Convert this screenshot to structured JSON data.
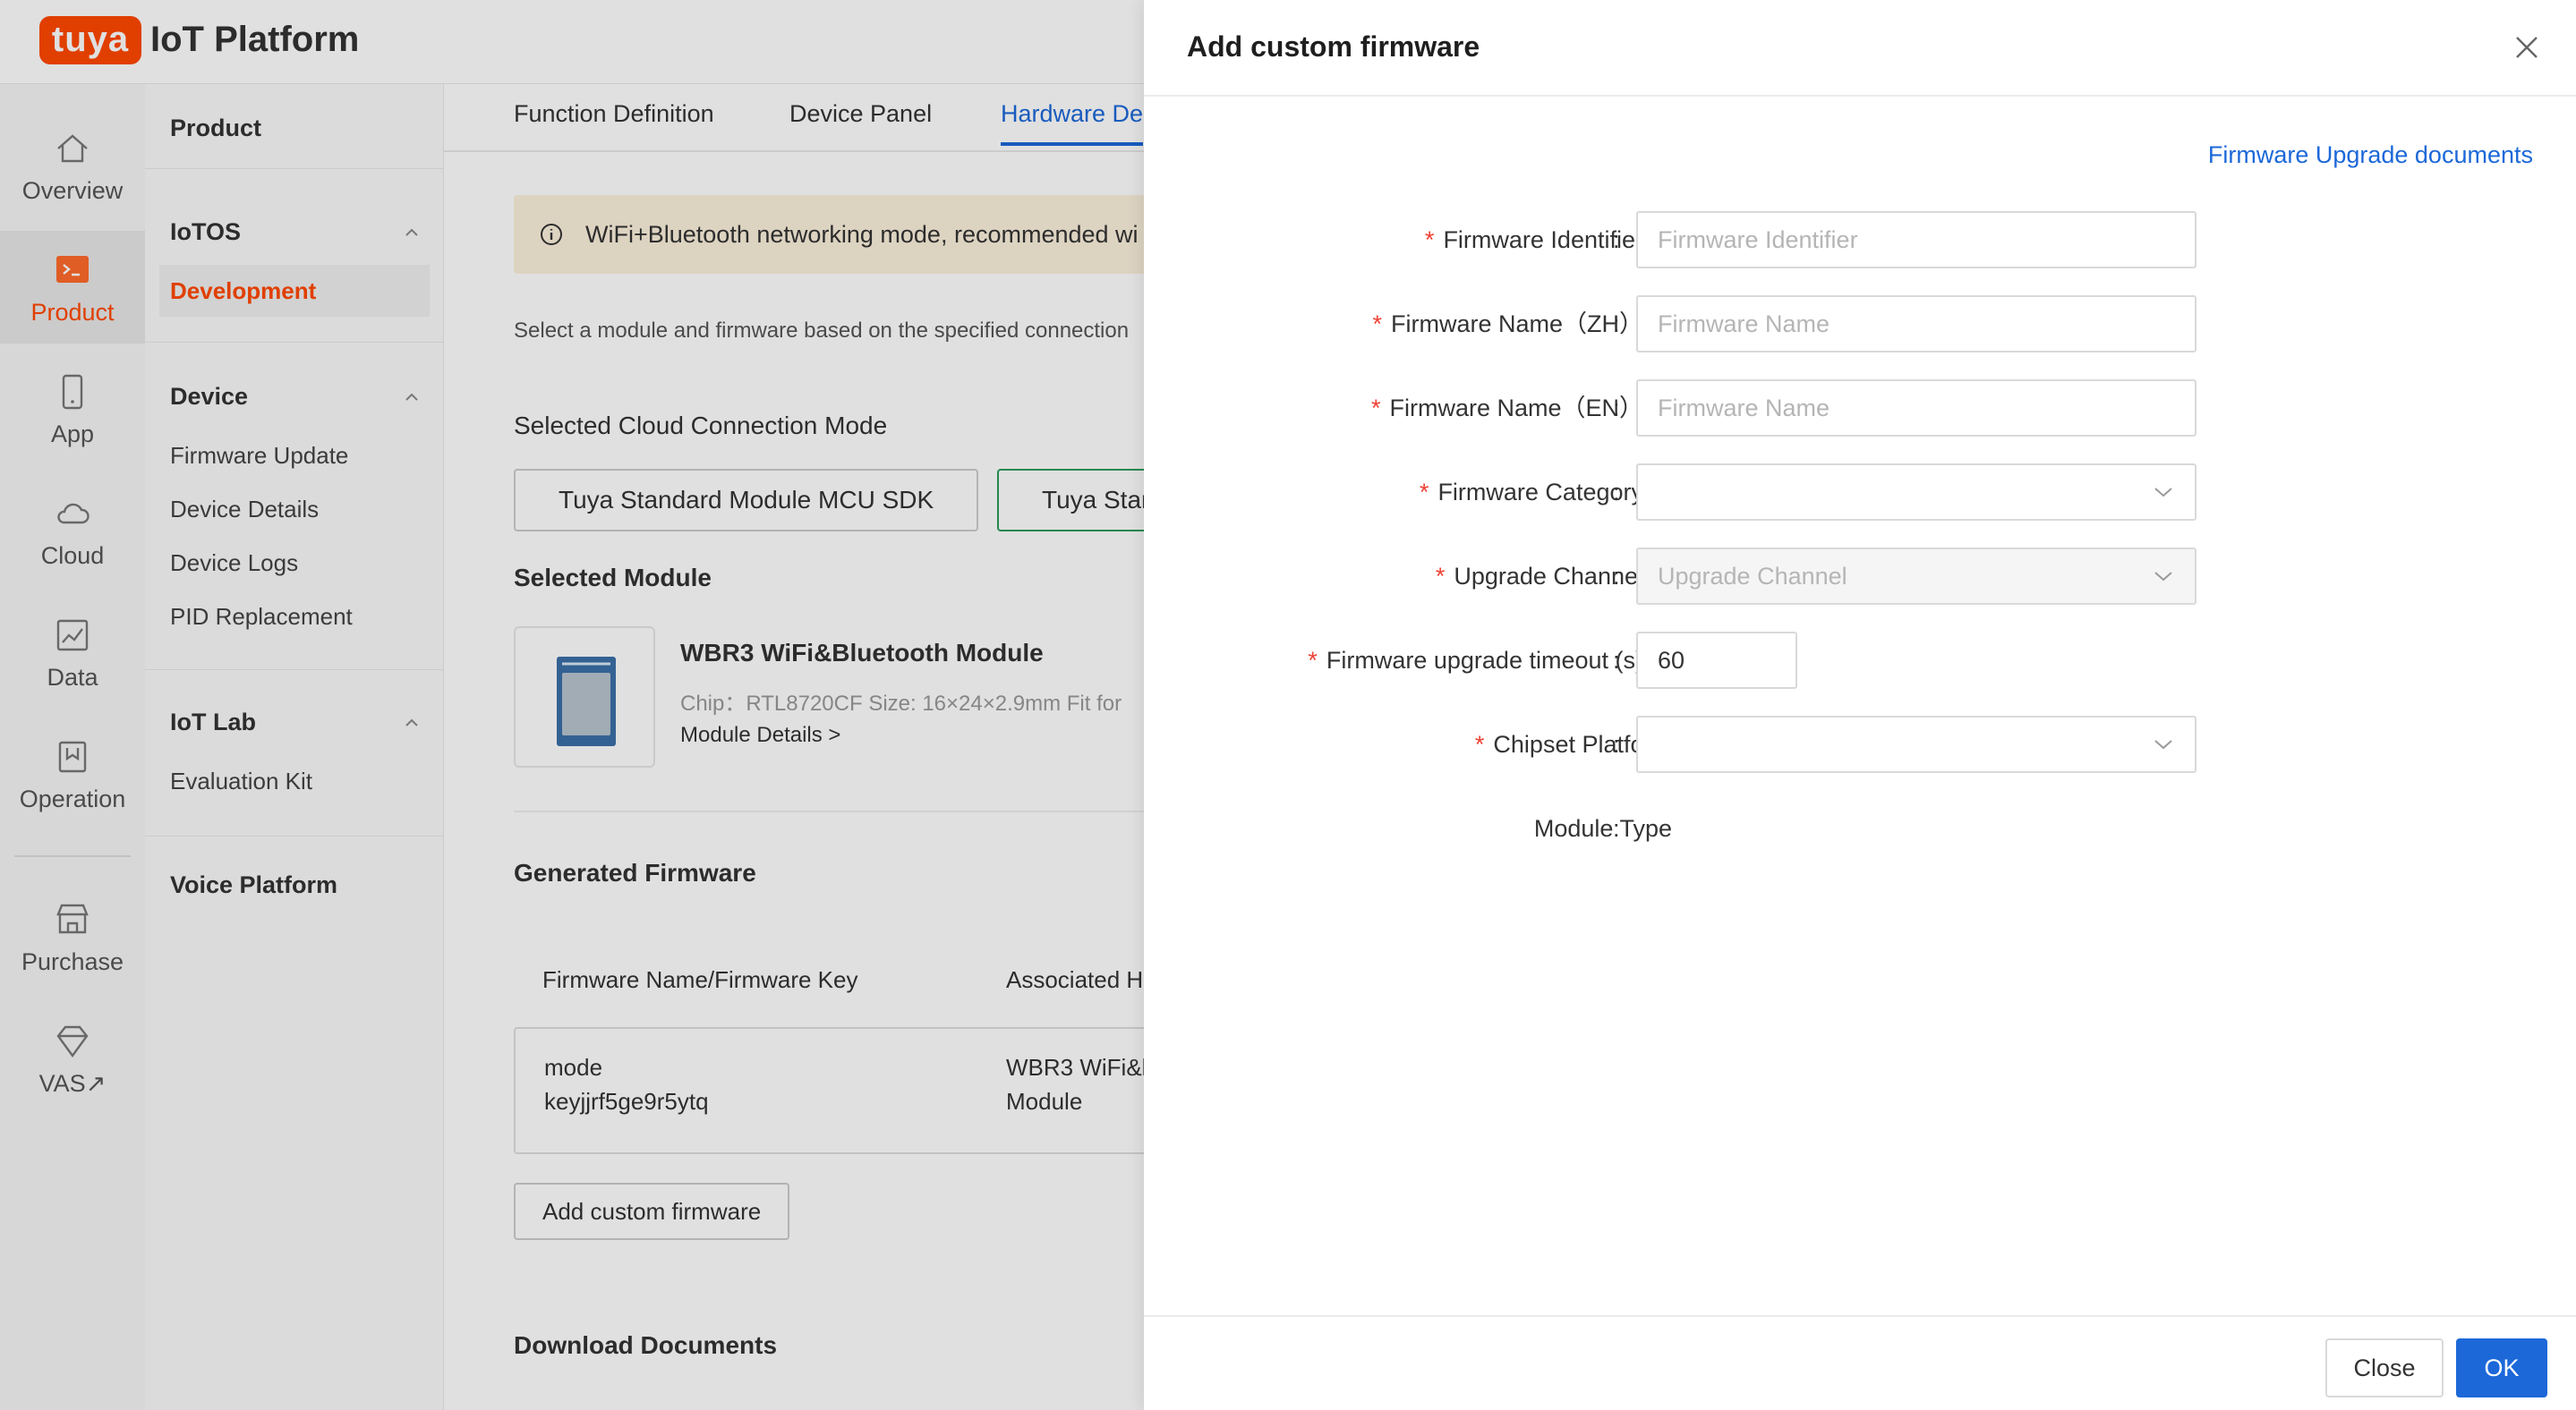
{
  "brand": {
    "logo_text": "tuya",
    "platform": "IoT Platform",
    "accent": "#ff4800"
  },
  "rail": {
    "items": [
      {
        "label": "Overview",
        "icon": "home-icon"
      },
      {
        "label": "Product",
        "icon": "terminal-icon",
        "active": true
      },
      {
        "label": "App",
        "icon": "phone-icon"
      },
      {
        "label": "Cloud",
        "icon": "cloud-icon"
      },
      {
        "label": "Data",
        "icon": "chart-icon"
      },
      {
        "label": "Operation",
        "icon": "bookmark-icon"
      },
      {
        "label": "Purchase",
        "icon": "shop-icon"
      },
      {
        "label": "VAS",
        "icon": "diamond-icon"
      }
    ],
    "vas_arrow": "↗"
  },
  "subnav": {
    "title": "Product",
    "groups": [
      {
        "label": "IoTOS",
        "items": [
          "Development"
        ]
      },
      {
        "label": "Device",
        "items": [
          "Firmware Update",
          "Device Details",
          "Device Logs",
          "PID Replacement"
        ]
      },
      {
        "label": "IoT Lab",
        "items": [
          "Evaluation Kit"
        ]
      }
    ],
    "voice": "Voice Platform"
  },
  "main": {
    "tabs": [
      "Function Definition",
      "Device Panel",
      "Hardware De"
    ],
    "alert": "WiFi+Bluetooth networking mode, recommended wi",
    "select_hint": "Select a module and firmware based on the specified connection",
    "conn_mode_heading": "Selected Cloud Connection Mode",
    "mode_buttons": [
      "Tuya Standard Module MCU SDK",
      "Tuya Star"
    ],
    "selected_module_heading": "Selected Module",
    "module": {
      "name": "WBR3 WiFi&Bluetooth Module",
      "specs": "Chip：RTL8720CF   Size: 16×24×2.9mm   Fit for",
      "details_link": "Module Details >"
    },
    "generated_heading": "Generated Firmware",
    "table": {
      "col1": "Firmware Name/Firmware Key",
      "col2": "Associated H",
      "row": {
        "name": "mode",
        "key": "keyjjrf5ge9r5ytq",
        "assoc1": "WBR3 WiFi&l",
        "assoc2": "Module"
      }
    },
    "add_custom_btn": "Add custom firmware",
    "download_heading": "Download Documents"
  },
  "drawer": {
    "title": "Add custom firmware",
    "doc_link": "Firmware Upgrade documents",
    "colon": ":",
    "fields": {
      "identifier": {
        "label": "Firmware Identifier",
        "placeholder": "Firmware Identifier"
      },
      "name_zh": {
        "label": "Firmware Name（ZH）",
        "placeholder": "Firmware Name"
      },
      "name_en": {
        "label": "Firmware Name（EN）",
        "placeholder": "Firmware Name"
      },
      "category": {
        "label": "Firmware Category",
        "value": ""
      },
      "channel": {
        "label": "Upgrade Channel",
        "placeholder": "Upgrade Channel"
      },
      "timeout": {
        "label": "Firmware upgrade timeout (s)",
        "value": "60"
      },
      "chipset": {
        "label": "Chipset Platform",
        "value": ""
      },
      "module_type": {
        "label": "Module Type"
      }
    },
    "required_mark": "*",
    "footer": {
      "close": "Close",
      "ok": "OK"
    },
    "primary_color": "#1c68d9"
  }
}
